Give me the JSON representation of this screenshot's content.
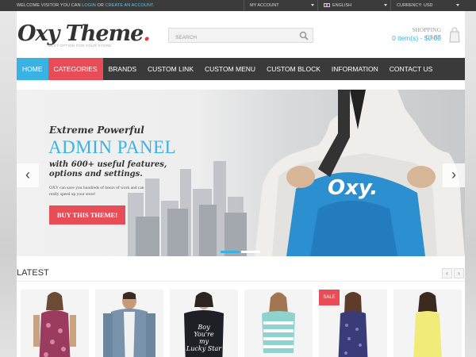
{
  "topbar": {
    "welcome_prefix": "WELCOME VISITOR YOU CAN ",
    "login": "LOGIN",
    "or": " OR ",
    "create_account": "CREATE AN ACCOUNT.",
    "my_account": "MY ACCOUNT",
    "language": "ENGLISH",
    "currency": "CURRENCY: USD"
  },
  "header": {
    "logo_text": "Oxy Theme",
    "logo_dot": ".",
    "tagline": "BEST OPTION FOR YOUR STORE",
    "search_placeholder": "SEARCH",
    "cart_label": "SHOPPING CART",
    "cart_items": "0 item(s) - $0.00"
  },
  "nav": {
    "items": [
      "HOME",
      "CATEGORIES",
      "BRANDS",
      "CUSTOM LINK",
      "CUSTOM MENU",
      "CUSTOM BLOCK",
      "INFORMATION",
      "CONTACT US"
    ]
  },
  "slider": {
    "title1": "Extreme Powerful",
    "title2": "ADMIN PANEL",
    "subtitle": "with 600+ useful features, options and settings.",
    "description": "OXY can save you hundreds of hours of work and can really speed up your store!",
    "button": "BUY THIS THEME!",
    "shirt_logo": "Oxy.",
    "prev": "‹",
    "next": "›"
  },
  "latest": {
    "title": "LATEST",
    "prev": "‹",
    "next": "›",
    "sale_badge": "SALE",
    "tee_text": "Boy You're my Lucky Star",
    "products": [
      {
        "name": "floral-tank-top"
      },
      {
        "name": "denim-jacket"
      },
      {
        "name": "boy-youre-my-lucky-star-tee"
      },
      {
        "name": "striped-tee"
      },
      {
        "name": "patterned-tank-top"
      },
      {
        "name": "yellow-tank-top"
      }
    ]
  },
  "colors": {
    "accent_blue": "#3ab2e4",
    "accent_red": "#e84c56",
    "nav_bg": "#3a3a3a"
  }
}
